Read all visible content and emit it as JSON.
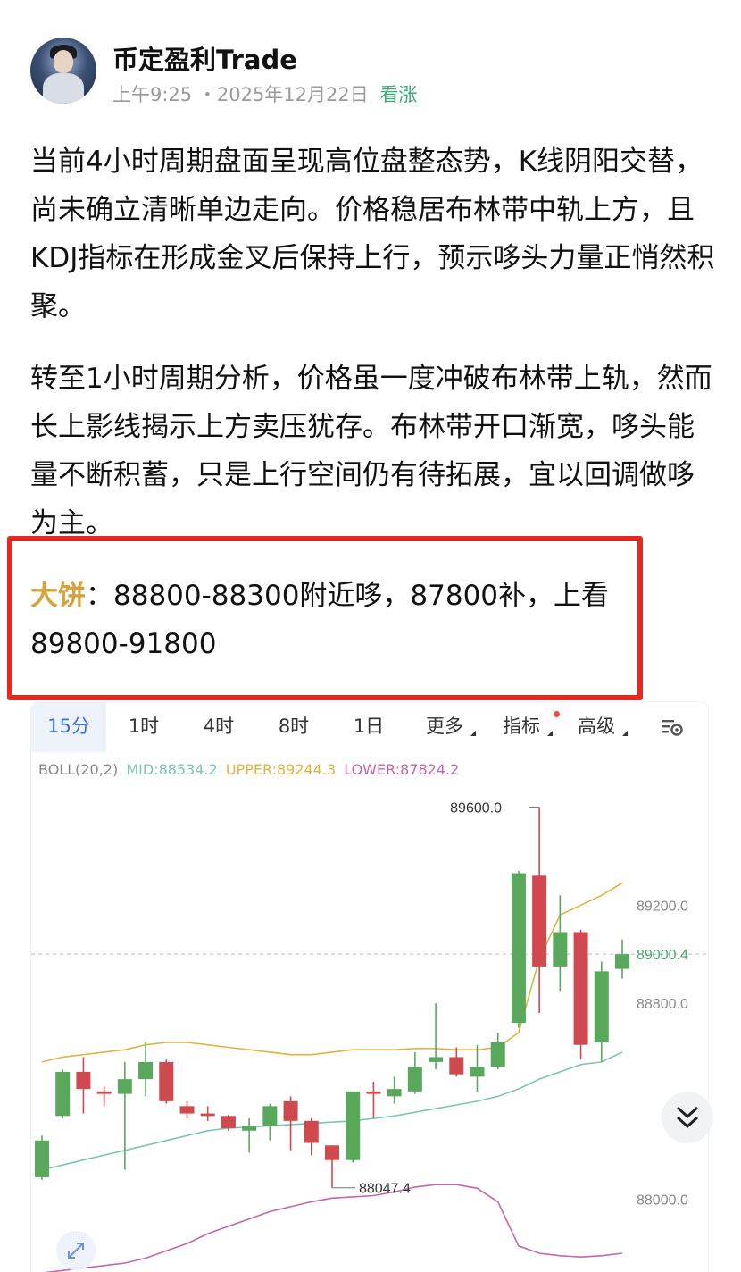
{
  "post": {
    "username": "币定盈利Trade",
    "time": "上午9:25",
    "date": "2025年12月22日",
    "sentiment": "看涨",
    "paragraph1": "当前4小时周期盘面呈现高位盘整态势，K线阴阳交替，尚未确立清晰单边走向。价格稳居布林带中轨上方，且KDJ指标在形成金叉后保持上行，预示哆头力量正悄然积聚。",
    "paragraph2": "转至1小时周期分析，价格虽一度冲破布林带上轨，然而长上影线揭示上方卖压犹存。布林带开口渐宽，哆头能量不断积蓄，只是上行空间仍有待拓展，宜以回调做哆为主。",
    "call_coin": "大饼",
    "call_text": "：88800-88300附近哆，87800补，上看89800-91800"
  },
  "chart": {
    "tabs": [
      {
        "label": "15分",
        "active": true
      },
      {
        "label": "1时"
      },
      {
        "label": "4时"
      },
      {
        "label": "8时"
      },
      {
        "label": "1日"
      },
      {
        "label": "更多"
      },
      {
        "label": "指标"
      },
      {
        "label": "高级"
      }
    ],
    "boll_label": "BOLL(20,2)",
    "boll_mid": "MID:88534.2",
    "boll_upper": "UPPER:89244.3",
    "boll_lower": "LOWER:87824.2",
    "colors": {
      "up": "#5aa85c",
      "down": "#d0494e",
      "mid": "#7cc6b5",
      "upper": "#e0b341",
      "lower": "#c566a6"
    }
  },
  "chart_data": {
    "type": "candlestick",
    "ylim": [
      87700,
      89700
    ],
    "y_ticks": [
      "89200.0",
      "88800.0",
      "88000.0"
    ],
    "current_price": "89000.4",
    "high_label": "89600.0",
    "low_label": "88047.4",
    "candles": [
      {
        "o": 88090,
        "c": 88240,
        "h": 88260,
        "l": 88080
      },
      {
        "o": 88340,
        "c": 88520,
        "h": 88530,
        "l": 88330
      },
      {
        "o": 88520,
        "c": 88450,
        "h": 88580,
        "l": 88350
      },
      {
        "o": 88440,
        "c": 88430,
        "h": 88460,
        "l": 88380
      },
      {
        "o": 88430,
        "c": 88490,
        "h": 88560,
        "l": 88120
      },
      {
        "o": 88490,
        "c": 88560,
        "h": 88640,
        "l": 88420
      },
      {
        "o": 88560,
        "c": 88400,
        "h": 88570,
        "l": 88390
      },
      {
        "o": 88380,
        "c": 88350,
        "h": 88400,
        "l": 88330
      },
      {
        "o": 88350,
        "c": 88340,
        "h": 88380,
        "l": 88320
      },
      {
        "o": 88340,
        "c": 88290,
        "h": 88345,
        "l": 88280
      },
      {
        "o": 88280,
        "c": 88300,
        "h": 88330,
        "l": 88190
      },
      {
        "o": 88300,
        "c": 88380,
        "h": 88390,
        "l": 88240
      },
      {
        "o": 88400,
        "c": 88320,
        "h": 88420,
        "l": 88200
      },
      {
        "o": 88320,
        "c": 88230,
        "h": 88330,
        "l": 88180
      },
      {
        "o": 88220,
        "c": 88160,
        "h": 88220,
        "l": 88047
      },
      {
        "o": 88160,
        "c": 88440,
        "h": 88440,
        "l": 88150
      },
      {
        "o": 88440,
        "c": 88430,
        "h": 88480,
        "l": 88330
      },
      {
        "o": 88420,
        "c": 88450,
        "h": 88500,
        "l": 88390
      },
      {
        "o": 88440,
        "c": 88540,
        "h": 88600,
        "l": 88430
      },
      {
        "o": 88560,
        "c": 88580,
        "h": 88800,
        "l": 88530
      },
      {
        "o": 88580,
        "c": 88510,
        "h": 88620,
        "l": 88500
      },
      {
        "o": 88500,
        "c": 88540,
        "h": 88630,
        "l": 88440
      },
      {
        "o": 88540,
        "c": 88640,
        "h": 88680,
        "l": 88530
      },
      {
        "o": 88720,
        "c": 89330,
        "h": 89340,
        "l": 88700
      },
      {
        "o": 89320,
        "c": 88950,
        "h": 89600,
        "l": 88760
      },
      {
        "o": 88950,
        "c": 89090,
        "h": 89240,
        "l": 88850
      },
      {
        "o": 89090,
        "c": 88630,
        "h": 89100,
        "l": 88570
      },
      {
        "o": 88640,
        "c": 88930,
        "h": 88970,
        "l": 88560
      },
      {
        "o": 88940,
        "c": 89000,
        "h": 89060,
        "l": 88900
      }
    ],
    "upper_band": [
      88560,
      88580,
      88590,
      88600,
      88610,
      88630,
      88640,
      88640,
      88630,
      88620,
      88610,
      88600,
      88590,
      88590,
      88600,
      88610,
      88610,
      88610,
      88615,
      88615,
      88610,
      88610,
      88620,
      88680,
      88980,
      89160,
      89200,
      89240,
      89290
    ],
    "mid_band": [
      88120,
      88140,
      88160,
      88180,
      88200,
      88220,
      88240,
      88260,
      88280,
      88290,
      88295,
      88300,
      88305,
      88310,
      88315,
      88320,
      88330,
      88340,
      88355,
      88370,
      88385,
      88400,
      88420,
      88450,
      88490,
      88520,
      88550,
      88560,
      88600
    ],
    "lower_band": [
      87700,
      87710,
      87720,
      87730,
      87740,
      87760,
      87790,
      87820,
      87860,
      87890,
      87920,
      87950,
      87970,
      87990,
      88005,
      88010,
      88015,
      88030,
      88050,
      88060,
      88060,
      88045,
      87990,
      87810,
      87780,
      87770,
      87765,
      87770,
      87780
    ]
  }
}
